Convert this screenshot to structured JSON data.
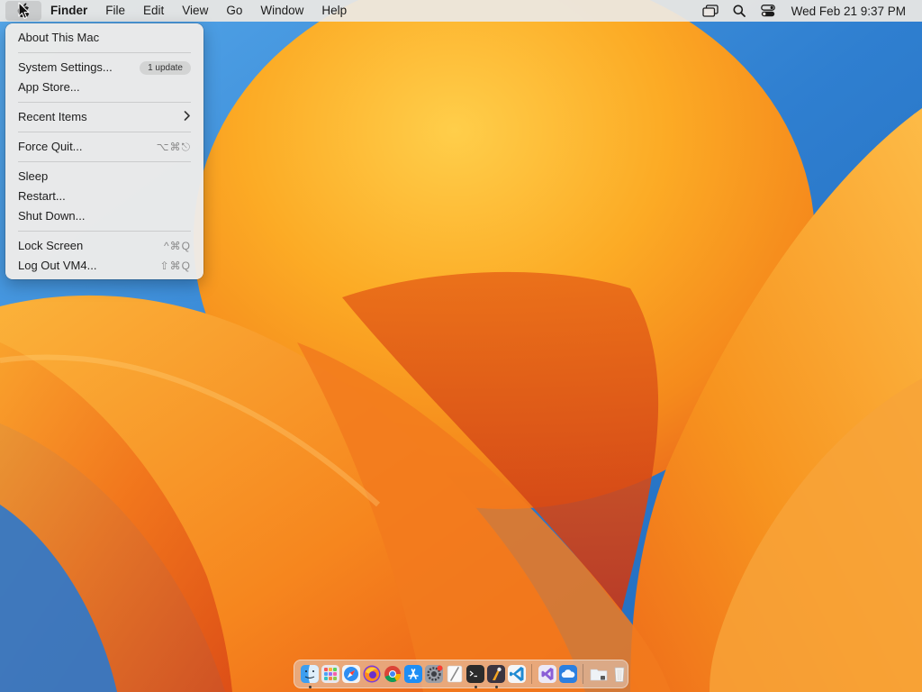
{
  "menubar": {
    "apple_icon": "apple-logo-icon",
    "items": [
      "Finder",
      "File",
      "Edit",
      "View",
      "Go",
      "Window",
      "Help"
    ],
    "status_icons": [
      "screen-mirroring-icon",
      "search-icon",
      "control-center-icon"
    ],
    "clock": "Wed Feb 21  9:37 PM"
  },
  "apple_menu": {
    "about": "About This Mac",
    "system_settings": "System Settings...",
    "system_settings_badge": "1 update",
    "app_store": "App Store...",
    "recent_items": "Recent Items",
    "force_quit": "Force Quit...",
    "force_quit_shortcut": "⌥⌘⎋",
    "sleep": "Sleep",
    "restart": "Restart...",
    "shut_down": "Shut Down...",
    "lock_screen": "Lock Screen",
    "lock_screen_shortcut": "^⌘Q",
    "log_out": "Log Out VM4...",
    "log_out_shortcut": "⇧⌘Q"
  },
  "dock": {
    "apps": [
      "finder-icon",
      "launchpad-icon",
      "safari-icon",
      "firefox-icon",
      "chrome-icon",
      "app-store-icon",
      "system-settings-icon",
      "textedit-icon",
      "terminal-icon",
      "instruments-icon",
      "vscode-icon"
    ],
    "extras": [
      "visual-studio-icon",
      "cloud-app-icon"
    ],
    "folders": [
      "downloads-folder-icon",
      "trash-icon"
    ]
  },
  "colors": {
    "menubar_bg": "#ece8e4",
    "menu_bg": "#eeecea",
    "wallpaper_orange": "#f6951f",
    "wallpaper_blue": "#2f7fd0"
  }
}
